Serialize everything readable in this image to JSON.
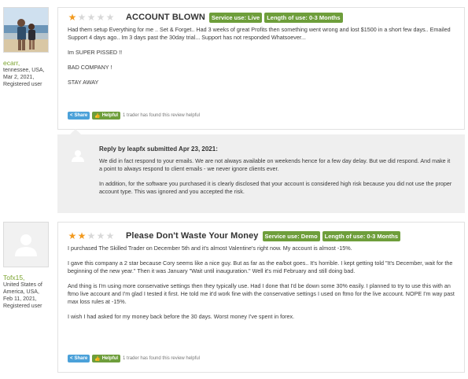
{
  "reviews": [
    {
      "user": {
        "name": "ecarr,",
        "location": "tennessee, USA,",
        "date": "Mar 2, 2021,",
        "role": "Registered user"
      },
      "rating": 1,
      "max_rating": 5,
      "title": "ACCOUNT BLOWN",
      "tags": [
        "Service use: Live",
        "Length of use: 0-3 Months"
      ],
      "paragraphs": [
        "Had them setup Everything for me .. Set & Forget.. Had 3 weeks of great Profits then something went wrong and lost $1500 in a short few days.. Emailed Support 4 days ago.. Im 3 days past the 30day trial... Support has not responded Whatsoever...",
        "Im SUPER PISSED !!",
        "BAD COMPANY !",
        "STAY AWAY"
      ],
      "share_label": "Share",
      "helpful_label": "Helpful",
      "helpful_text": "1 trader has found this review helpful"
    },
    {
      "user": {
        "name": "Tofx15,",
        "location": "United States of America, USA,",
        "date": "Feb 11, 2021,",
        "role": "Registered user"
      },
      "rating": 2,
      "max_rating": 5,
      "title": "Please Don't Waste Your Money",
      "tags": [
        "Service use: Demo",
        "Length of use: 0-3 Months"
      ],
      "paragraphs": [
        "I purchased The Skilled Trader on December 5th and it's almost Valentine's right now. My account is almost -15%.",
        "I gave this company a 2 star because Cory seems like a nice guy. But as far as the ea/bot goes.. It's horrible. I kept getting told \"It's December, wait for the beginning of the new year.\" Then it was January \"Wait until inauguration.\" Well it's mid February and still doing bad.",
        "And thing is I'm using more conservative settings then they typically use. Had I done that I'd be down some 30% easily. I planned to try to use this with an ftmo live account and I'm glad I tested it first. He told me it'd work fine with the conservative settings I used on ftmo for the live account. NOPE I'm way past max loss rules at -15%.",
        "I wish I had asked for my money back before the 30 days. Worst money I've spent in forex."
      ],
      "share_label": "Share",
      "helpful_label": "Helpful",
      "helpful_text": "1 trader has found this review helpful"
    }
  ],
  "reply": {
    "heading": "Reply by leapfx submitted Apr 23, 2021:",
    "paragraphs": [
      "We did in fact respond to your emails. We are not always available on weekends hence for a few day delay. But we did respond. And make it a point to always respond to client emails - we never ignore clients ever.",
      "In addition, for the software you purchased it is clearly disclosed that your account is considered high risk because you did not use the proper account type. This was ignored and you accepted the risk."
    ]
  },
  "colors": {
    "star_on": "#f29a1f",
    "star_off": "#d8d8d8",
    "tag_bg": "#6e9e3b",
    "share_bg": "#4ba1d9",
    "username": "#7aa32e",
    "reply_bg": "#efefef"
  },
  "icons": {
    "share": "share-icon",
    "helpful": "thumbs-up-icon",
    "default_avatar": "user-silhouette-icon",
    "star": "star-icon"
  }
}
